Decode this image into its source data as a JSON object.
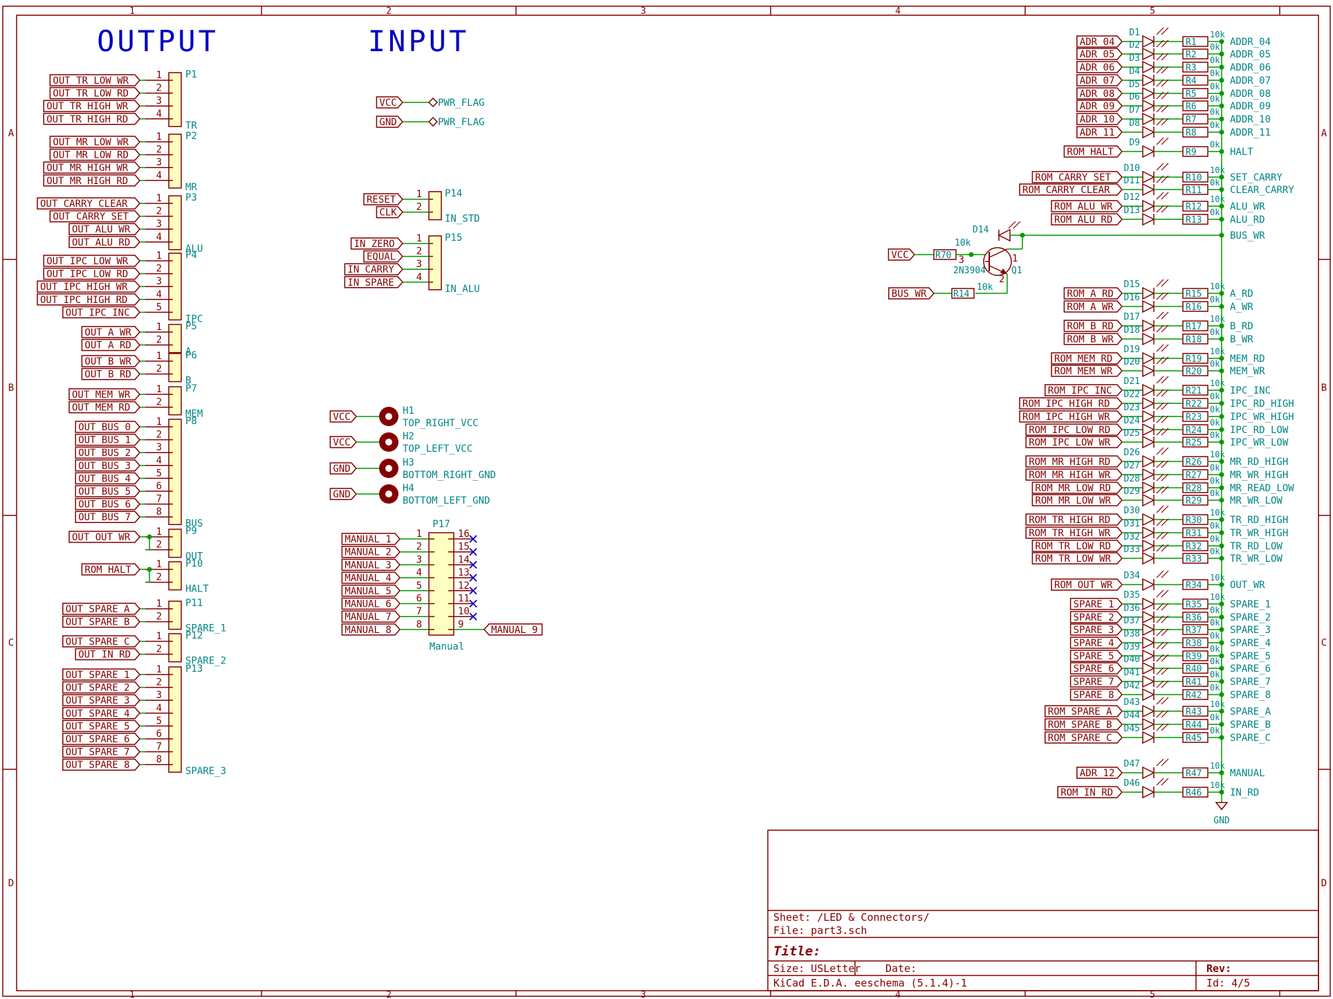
{
  "colors": {
    "frame": "#840000",
    "wire": "#009900",
    "junction": "#009900",
    "comp_fill": "#ffffc2",
    "pin": "#840000",
    "net": "#008484",
    "title_blue": "#0000c2",
    "no_connect": "#0000c2",
    "hole": "#840000"
  },
  "frame": {
    "columns": [
      "1",
      "2",
      "3",
      "4",
      "5"
    ],
    "rows": [
      "A",
      "B",
      "C",
      "D"
    ]
  },
  "headings": {
    "output": "OUTPUT",
    "input": "INPUT"
  },
  "output_connectors": [
    {
      "ref": "P1",
      "value": "TR",
      "pins": [
        "OUT_TR_LOW_WR",
        "OUT_TR_LOW_RD",
        "OUT_TR_HIGH_WR",
        "OUT_TR_HIGH_RD"
      ]
    },
    {
      "ref": "P2",
      "value": "MR",
      "pins": [
        "OUT_MR_LOW_WR",
        "OUT_MR_LOW_RD",
        "OUT_MR_HIGH_WR",
        "OUT_MR_HIGH_RD"
      ]
    },
    {
      "ref": "P3",
      "value": "ALU",
      "pins": [
        "OUT_CARRY_CLEAR",
        "OUT_CARRY_SET",
        "OUT_ALU_WR",
        "OUT_ALU_RD"
      ]
    },
    {
      "ref": "P4",
      "value": "IPC",
      "pins": [
        "OUT_IPC_LOW_WR",
        "OUT_IPC_LOW_RD",
        "OUT_IPC_HIGH_WR",
        "OUT_IPC_HIGH_RD",
        "OUT_IPC_INC"
      ]
    },
    {
      "ref": "P5",
      "value": "A",
      "pins": [
        "OUT_A_WR",
        "OUT_A_RD"
      ]
    },
    {
      "ref": "P6",
      "value": "B",
      "pins": [
        "OUT_B_WR",
        "OUT_B_RD"
      ]
    },
    {
      "ref": "P7",
      "value": "MEM",
      "pins": [
        "OUT_MEM_WR",
        "OUT_MEM_RD"
      ]
    },
    {
      "ref": "P8",
      "value": "BUS",
      "pins": [
        "OUT_BUS_0",
        "OUT_BUS_1",
        "OUT_BUS_2",
        "OUT_BUS_3",
        "OUT_BUS_4",
        "OUT_BUS_5",
        "OUT_BUS_6",
        "OUT_BUS_7"
      ]
    },
    {
      "ref": "P9",
      "value": "OUT",
      "pins": [
        "OUT_OUT_WR",
        ""
      ],
      "tied": true
    },
    {
      "ref": "P10",
      "value": "HALT",
      "pins": [
        "ROM_HALT",
        ""
      ],
      "tied": true
    },
    {
      "ref": "P11",
      "value": "SPARE_1",
      "pins": [
        "OUT_SPARE_A",
        "OUT_SPARE_B"
      ]
    },
    {
      "ref": "P12",
      "value": "SPARE_2",
      "pins": [
        "OUT_SPARE_C",
        "OUT_IN_RD"
      ]
    },
    {
      "ref": "P13",
      "value": "SPARE_3",
      "pins": [
        "OUT_SPARE_1",
        "OUT_SPARE_2",
        "OUT_SPARE_3",
        "OUT_SPARE_4",
        "OUT_SPARE_5",
        "OUT_SPARE_6",
        "OUT_SPARE_7",
        "OUT_SPARE_8"
      ]
    }
  ],
  "power_flags": [
    {
      "net": "VCC",
      "flag": "PWR_FLAG"
    },
    {
      "net": "GND",
      "flag": "PWR_FLAG"
    }
  ],
  "input_connectors": [
    {
      "ref": "P14",
      "value": "IN_STD",
      "pins": [
        "RESET",
        "CLK"
      ]
    },
    {
      "ref": "P15",
      "value": "IN_ALU",
      "pins": [
        "IN_ZERO",
        "EQUAL",
        "IN_CARRY",
        "IN_SPARE"
      ]
    }
  ],
  "mounting_holes": [
    {
      "ref": "H1",
      "value": "TOP_RIGHT_VCC",
      "net": "VCC"
    },
    {
      "ref": "H2",
      "value": "TOP_LEFT_VCC",
      "net": "VCC"
    },
    {
      "ref": "H3",
      "value": "BOTTOM_RIGHT_GND",
      "net": "GND"
    },
    {
      "ref": "H4",
      "value": "BOTTOM_LEFT_GND",
      "net": "GND"
    }
  ],
  "manual_header": {
    "ref": "P17",
    "value": "Manual",
    "left": [
      {
        "pin": "1",
        "net": "MANUAL_1"
      },
      {
        "pin": "2",
        "net": "MANUAL_2"
      },
      {
        "pin": "3",
        "net": "MANUAL_3"
      },
      {
        "pin": "4",
        "net": "MANUAL_4"
      },
      {
        "pin": "5",
        "net": "MANUAL_5"
      },
      {
        "pin": "6",
        "net": "MANUAL_6"
      },
      {
        "pin": "7",
        "net": "MANUAL_7"
      },
      {
        "pin": "8",
        "net": "MANUAL_8"
      }
    ],
    "right": [
      {
        "pin": "16",
        "net": ""
      },
      {
        "pin": "15",
        "net": ""
      },
      {
        "pin": "14",
        "net": ""
      },
      {
        "pin": "13",
        "net": ""
      },
      {
        "pin": "12",
        "net": ""
      },
      {
        "pin": "11",
        "net": ""
      },
      {
        "pin": "10",
        "net": ""
      },
      {
        "pin": "9",
        "net": "MANUAL_9"
      }
    ]
  },
  "led_rows": [
    {
      "input": "ADR_04",
      "d": "D1",
      "r": "R1",
      "rv": "10k",
      "out": "ADDR_04"
    },
    {
      "input": "ADR_05",
      "d": "D2",
      "r": "R2",
      "rv": "0k",
      "out": "ADDR_05"
    },
    {
      "input": "ADR_06",
      "d": "D3",
      "r": "R3",
      "rv": "0k",
      "out": "ADDR_06"
    },
    {
      "input": "ADR_07",
      "d": "D4",
      "r": "R4",
      "rv": "0k",
      "out": "ADDR_07"
    },
    {
      "input": "ADR_08",
      "d": "D5",
      "r": "R5",
      "rv": "0k",
      "out": "ADDR_08"
    },
    {
      "input": "ADR_09",
      "d": "D6",
      "r": "R6",
      "rv": "0k",
      "out": "ADDR_09"
    },
    {
      "input": "ADR_10",
      "d": "D7",
      "r": "R7",
      "rv": "0k",
      "out": "ADDR_10"
    },
    {
      "input": "ADR_11",
      "d": "D8",
      "r": "R8",
      "rv": "0k",
      "out": "ADDR_11"
    },
    {
      "input": "ROM_HALT",
      "d": "D9",
      "r": "R9",
      "rv": "0k",
      "out": "HALT"
    },
    {
      "input": "ROM_CARRY_SET",
      "d": "D10",
      "r": "R10",
      "rv": "10k",
      "out": "SET_CARRY"
    },
    {
      "input": "ROM_CARRY_CLEAR",
      "d": "D11",
      "r": "R11",
      "rv": "0k",
      "out": "CLEAR_CARRY"
    },
    {
      "input": "ROM_ALU_WR",
      "d": "D12",
      "r": "R12",
      "rv": "10k",
      "out": "ALU_WR"
    },
    {
      "input": "ROM_ALU_RD",
      "d": "D13",
      "r": "R13",
      "rv": "0k",
      "out": "ALU_RD"
    },
    {
      "input": "ROM_A_RD",
      "d": "D15",
      "r": "R15",
      "rv": "10k",
      "out": "A_RD"
    },
    {
      "input": "ROM_A_WR",
      "d": "D16",
      "r": "R16",
      "rv": "0k",
      "out": "A_WR"
    },
    {
      "input": "ROM_B_RD",
      "d": "D17",
      "r": "R17",
      "rv": "10k",
      "out": "B_RD"
    },
    {
      "input": "ROM_B_WR",
      "d": "D18",
      "r": "R18",
      "rv": "0k",
      "out": "B_WR"
    },
    {
      "input": "ROM_MEM_RD",
      "d": "D19",
      "r": "R19",
      "rv": "10k",
      "out": "MEM_RD"
    },
    {
      "input": "ROM_MEM_WR",
      "d": "D20",
      "r": "R20",
      "rv": "0k",
      "out": "MEM_WR"
    },
    {
      "input": "ROM_IPC_INC",
      "d": "D21",
      "r": "R21",
      "rv": "10k",
      "out": "IPC_INC"
    },
    {
      "input": "ROM_IPC_HIGH_RD",
      "d": "D22",
      "r": "R22",
      "rv": "0k",
      "out": "IPC_RD_HIGH"
    },
    {
      "input": "ROM_IPC_HIGH_WR",
      "d": "D23",
      "r": "R23",
      "rv": "0k",
      "out": "IPC_WR_HIGH"
    },
    {
      "input": "ROM_IPC_LOW_RD",
      "d": "D24",
      "r": "R24",
      "rv": "0k",
      "out": "IPC_RD_LOW"
    },
    {
      "input": "ROM_IPC_LOW_WR",
      "d": "D25",
      "r": "R25",
      "rv": "0k",
      "out": "IPC_WR_LOW"
    },
    {
      "input": "ROM_MR_HIGH_RD",
      "d": "D26",
      "r": "R26",
      "rv": "10k",
      "out": "MR_RD_HIGH"
    },
    {
      "input": "ROM_MR_HIGH_WR",
      "d": "D27",
      "r": "R27",
      "rv": "0k",
      "out": "MR_WR_HIGH"
    },
    {
      "input": "ROM_MR_LOW_RD",
      "d": "D28",
      "r": "R28",
      "rv": "0k",
      "out": "MR_READ_LOW"
    },
    {
      "input": "ROM_MR_LOW_WR",
      "d": "D29",
      "r": "R29",
      "rv": "0k",
      "out": "MR_WR_LOW"
    },
    {
      "input": "ROM_TR_HIGH_RD",
      "d": "D30",
      "r": "R30",
      "rv": "10k",
      "out": "TR_RD_HIGH"
    },
    {
      "input": "ROM_TR_HIGH_WR",
      "d": "D31",
      "r": "R31",
      "rv": "0k",
      "out": "TR_WR_HIGH"
    },
    {
      "input": "ROM_TR_LOW_RD",
      "d": "D32",
      "r": "R32",
      "rv": "0k",
      "out": "TR_RD_LOW"
    },
    {
      "input": "ROM_TR_LOW_WR",
      "d": "D33",
      "r": "R33",
      "rv": "0k",
      "out": "TR_WR_LOW"
    },
    {
      "input": "ROM_OUT_WR",
      "d": "D34",
      "r": "R34",
      "rv": "10k",
      "out": "OUT_WR"
    },
    {
      "input": "SPARE_1",
      "d": "D35",
      "r": "R35",
      "rv": "10k",
      "out": "SPARE_1"
    },
    {
      "input": "SPARE_2",
      "d": "D36",
      "r": "R36",
      "rv": "0k",
      "out": "SPARE_2"
    },
    {
      "input": "SPARE_3",
      "d": "D37",
      "r": "R37",
      "rv": "0k",
      "out": "SPARE_3"
    },
    {
      "input": "SPARE_4",
      "d": "D38",
      "r": "R38",
      "rv": "0k",
      "out": "SPARE_4"
    },
    {
      "input": "SPARE_5",
      "d": "D39",
      "r": "R39",
      "rv": "0k",
      "out": "SPARE_5"
    },
    {
      "input": "SPARE_6",
      "d": "D40",
      "r": "R40",
      "rv": "0k",
      "out": "SPARE_6"
    },
    {
      "input": "SPARE_7",
      "d": "D41",
      "r": "R41",
      "rv": "0k",
      "out": "SPARE_7"
    },
    {
      "input": "SPARE_8",
      "d": "D42",
      "r": "R42",
      "rv": "0k",
      "out": "SPARE_8"
    },
    {
      "input": "ROM_SPARE_A",
      "d": "D43",
      "r": "R43",
      "rv": "10k",
      "out": "SPARE_A"
    },
    {
      "input": "ROM_SPARE_B",
      "d": "D44",
      "r": "R44",
      "rv": "0k",
      "out": "SPARE_B"
    },
    {
      "input": "ROM_SPARE_C",
      "d": "D45",
      "r": "R45",
      "rv": "0k",
      "out": "SPARE_C"
    },
    {
      "input": "ADR_12",
      "d": "D47",
      "r": "R47",
      "rv": "10k",
      "out": "MANUAL"
    },
    {
      "input": "ROM_IN_RD",
      "d": "D46",
      "r": "R46",
      "rv": "10k",
      "out": "IN_RD"
    }
  ],
  "transistor": {
    "ref": "Q1",
    "value": "2N3904",
    "base_pin": "3",
    "collector_pin": "1",
    "emitter_pin": "2",
    "base_input": "VCC",
    "base_res": "R70",
    "base_res_value": "10k",
    "emitter_input": "BUS_WR",
    "emitter_res": "R14",
    "emitter_res_value": "10k",
    "led": "D14",
    "out": "BUS_WR"
  },
  "gnd_label": "GND",
  "title_block": {
    "sheet_label": "Sheet: /LED & Connectors/",
    "file_label": "File: part3.sch",
    "title_label": "Title:",
    "size_label": "Size: USLetter",
    "date_label": "Date:",
    "rev_label": "Rev:",
    "app_label": "KiCad E.D.A.  eeschema (5.1.4)-1",
    "id_label": "Id: 4/5"
  }
}
